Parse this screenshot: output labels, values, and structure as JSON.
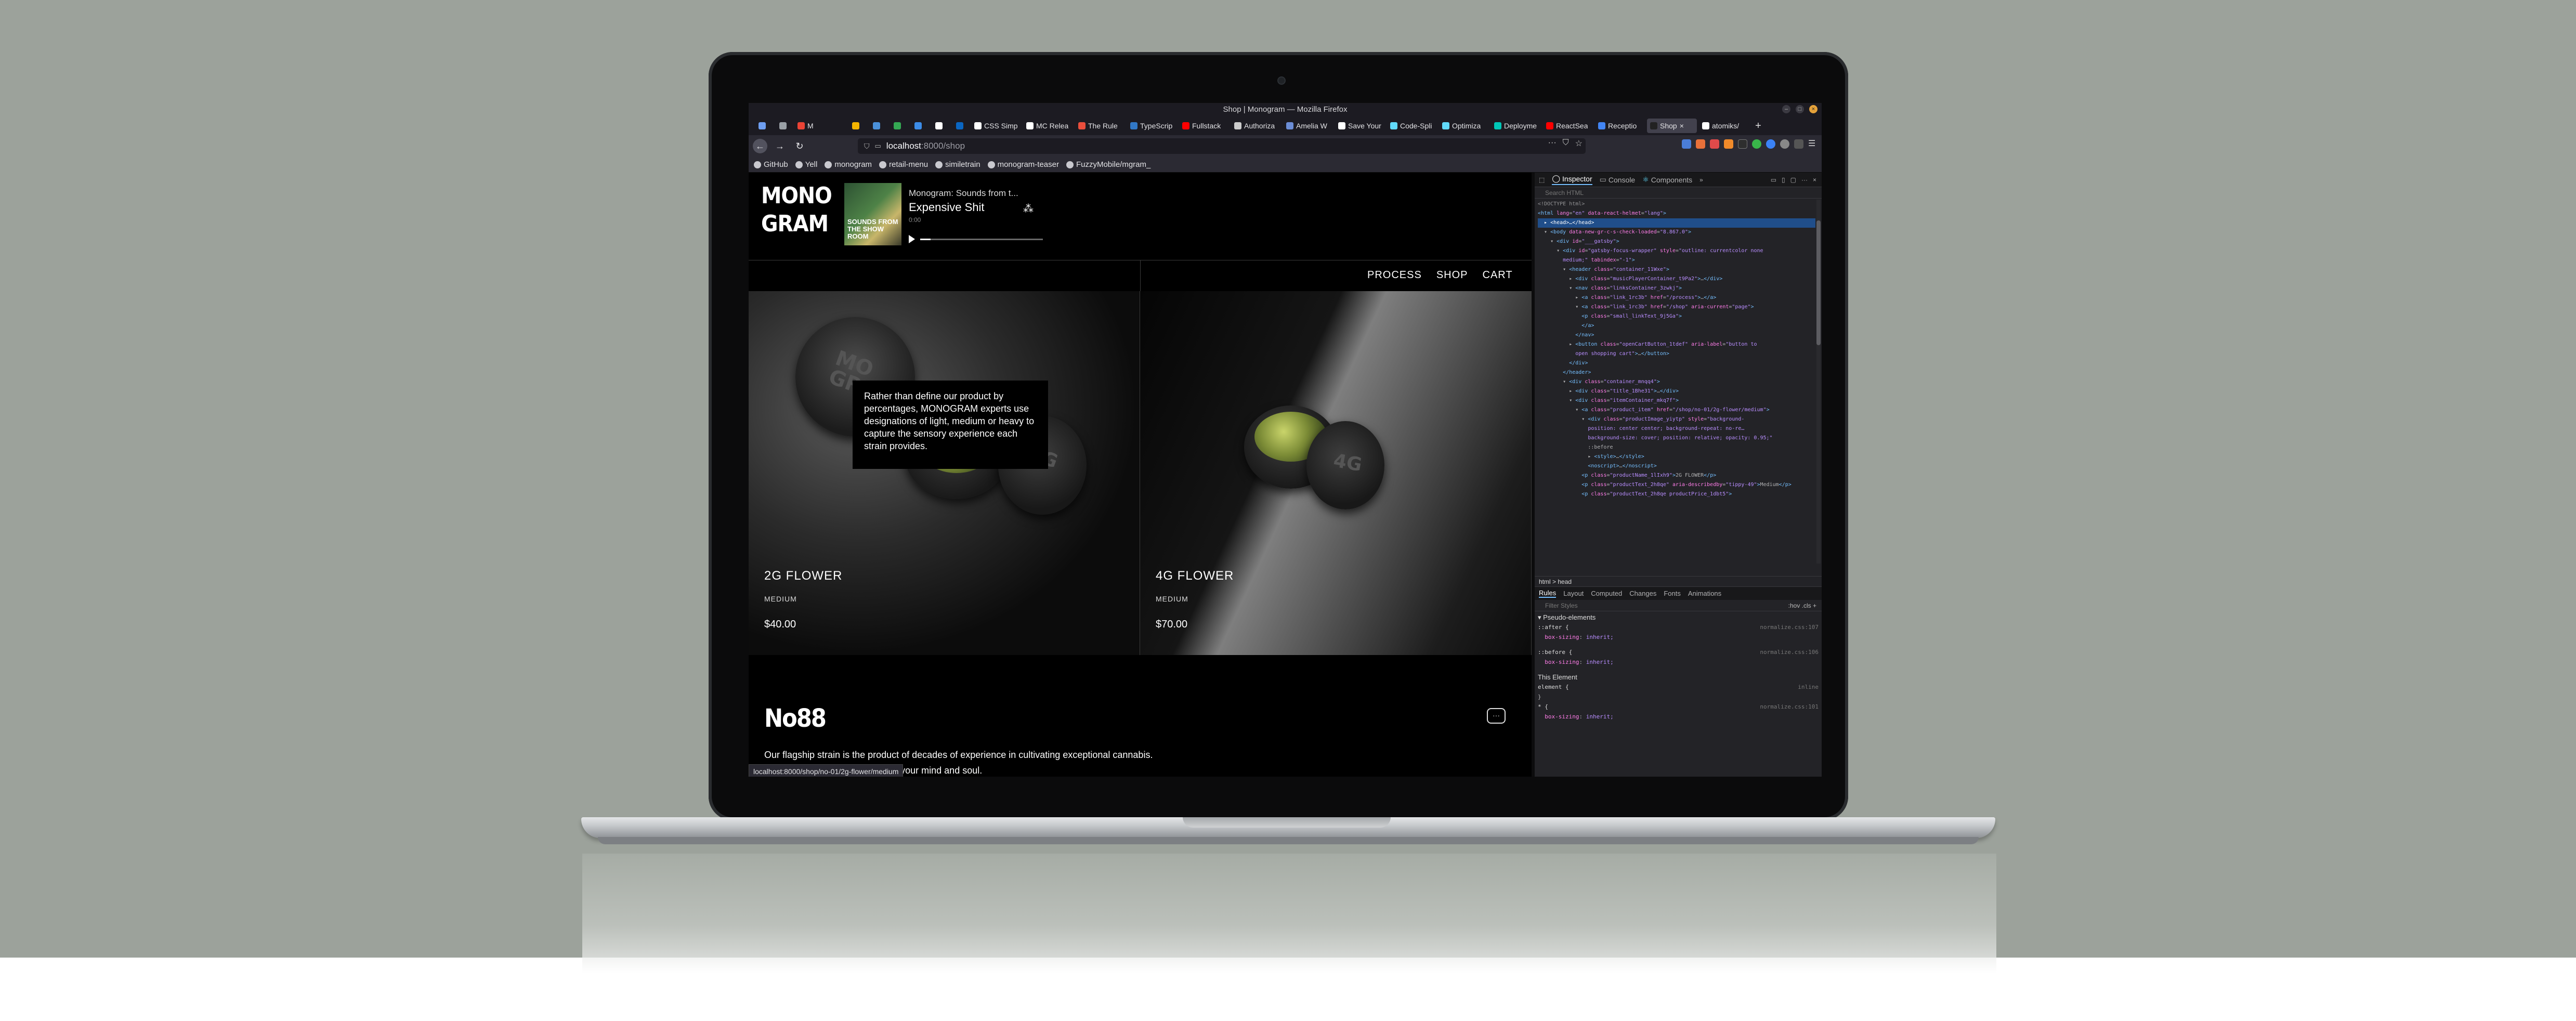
{
  "window": {
    "title": "Shop | Monogram — Mozilla Firefox"
  },
  "tabs": [
    {
      "label": "",
      "color": "#6e9ef0"
    },
    {
      "label": "",
      "color": "#9aa0a6"
    },
    {
      "label": "M",
      "color": "#ea4335"
    },
    {
      "label": "",
      "color": "#f4b400"
    },
    {
      "label": "",
      "color": "#4a90d9"
    },
    {
      "label": "",
      "color": "#34a853"
    },
    {
      "label": "",
      "color": "#3c8ce7"
    },
    {
      "label": "",
      "color": "#ffffff"
    },
    {
      "label": "",
      "color": "#0a66c2"
    },
    {
      "label": "CSS Simp",
      "color": "#ffffff"
    },
    {
      "label": "MC Relea",
      "color": "#ffffff"
    },
    {
      "label": "The Rule",
      "color": "#e94e3c"
    },
    {
      "label": "TypeScrip",
      "color": "#3178c6"
    },
    {
      "label": "Fullstack",
      "color": "#ff0000"
    },
    {
      "label": "Authoriza",
      "color": "#cccccc"
    },
    {
      "label": "Amelia W",
      "color": "#6b8dd6"
    },
    {
      "label": "Save Your",
      "color": "#ffffff"
    },
    {
      "label": "Code-Spli",
      "color": "#61dafb"
    },
    {
      "label": "Optimiza",
      "color": "#61dafb"
    },
    {
      "label": "Deployme",
      "color": "#00c7b7"
    },
    {
      "label": "ReactSea",
      "color": "#ff0000"
    },
    {
      "label": "Receptio",
      "color": "#4285f4"
    },
    {
      "label": "Shop",
      "color": "#222222"
    },
    {
      "label": "atomiks/",
      "color": "#ffffff"
    }
  ],
  "navbar": {
    "url_host": "localhost",
    "url_path": ":8000/shop"
  },
  "bookmarks": [
    {
      "label": "GitHub"
    },
    {
      "label": "Yell"
    },
    {
      "label": "monogram"
    },
    {
      "label": "retail-menu"
    },
    {
      "label": "similetrain"
    },
    {
      "label": "monogram-teaser"
    },
    {
      "label": "FuzzyMobile/mgram_"
    }
  ],
  "page": {
    "logo_line1": "MONO",
    "logo_line2": "GRAM",
    "player": {
      "cover_text": "SOUNDS FROM THE SHOW ROOM",
      "track": "Monogram: Sounds from t...",
      "title": "Expensive Shit",
      "time": "0:00"
    },
    "nav": [
      "PROCESS",
      "SHOP",
      "CART"
    ],
    "products": [
      {
        "name": "2G FLOWER",
        "type": "MEDIUM",
        "price": "$40.00",
        "emboss": "2G"
      },
      {
        "name": "4G FLOWER",
        "type": "MEDIUM",
        "price": "$70.00",
        "emboss": "4G"
      }
    ],
    "tooltip": "Rather than define our product by percentages, MONOGRAM experts use designations of light, medium or heavy to capture the sensory experience each strain provides.",
    "section_logo": "No88",
    "description_line1": "Our flagship strain is the product of decades of experience in cultivating exceptional cannabis.",
    "description_line2": "d meticulously crafted to elevate your mind and soul.",
    "status_url": "localhost:8000/shop/no-01/2g-flower/medium"
  },
  "devtools": {
    "tabs": [
      "Inspector",
      "Console",
      "Components"
    ],
    "search_placeholder": "Search HTML",
    "breadcrumb": "html > head",
    "side_tabs": [
      "Rules",
      "Layout",
      "Computed",
      "Changes",
      "Fonts",
      "Animations"
    ],
    "filter_placeholder": "Filter Styles",
    "filter_right": ":hov .cls +",
    "rules": [
      {
        "selector": "::after {",
        "source": "normalize.css:107",
        "prop": "box-sizing",
        "val": "inherit;"
      },
      {
        "selector": "::before {",
        "source": "normalize.css:106",
        "prop": "box-sizing",
        "val": "inherit;"
      }
    ],
    "this_element": "This Element",
    "element_rule": "element {",
    "star_rule": "* {",
    "star_source": "normalize.css:101",
    "star_prop": "box-sizing",
    "star_val": "inherit;",
    "pseudo_label": "Pseudo-elements"
  }
}
